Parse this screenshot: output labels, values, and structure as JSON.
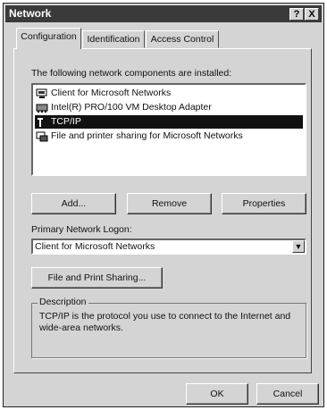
{
  "window": {
    "title": "Network"
  },
  "title_buttons": {
    "help": "?",
    "close": "X"
  },
  "tabs": [
    {
      "label": "Configuration"
    },
    {
      "label": "Identification"
    },
    {
      "label": "Access Control"
    }
  ],
  "components": {
    "heading": "The following network components are installed:",
    "items": [
      {
        "label": "Client for Microsoft Networks",
        "icon": "client-icon"
      },
      {
        "label": "Intel(R) PRO/100 VM Desktop Adapter",
        "icon": "network-adapter-icon"
      },
      {
        "label": "TCP/IP",
        "icon": "protocol-icon",
        "selected": true
      },
      {
        "label": "File and printer sharing for Microsoft Networks",
        "icon": "service-icon"
      }
    ]
  },
  "buttons": {
    "add": "Add...",
    "remove": "Remove",
    "properties": "Properties"
  },
  "logon": {
    "label": "Primary Network Logon:",
    "value": "Client for Microsoft Networks"
  },
  "file_sharing": {
    "label": "File and Print Sharing..."
  },
  "description": {
    "title": "Description",
    "text": "TCP/IP is the protocol you use to connect to the Internet and wide-area networks."
  },
  "dialog": {
    "ok": "OK",
    "cancel": "Cancel"
  },
  "colors": {
    "titlebar": "#3a3a3a",
    "face": "#d4d4d4",
    "selection": "#111111"
  }
}
